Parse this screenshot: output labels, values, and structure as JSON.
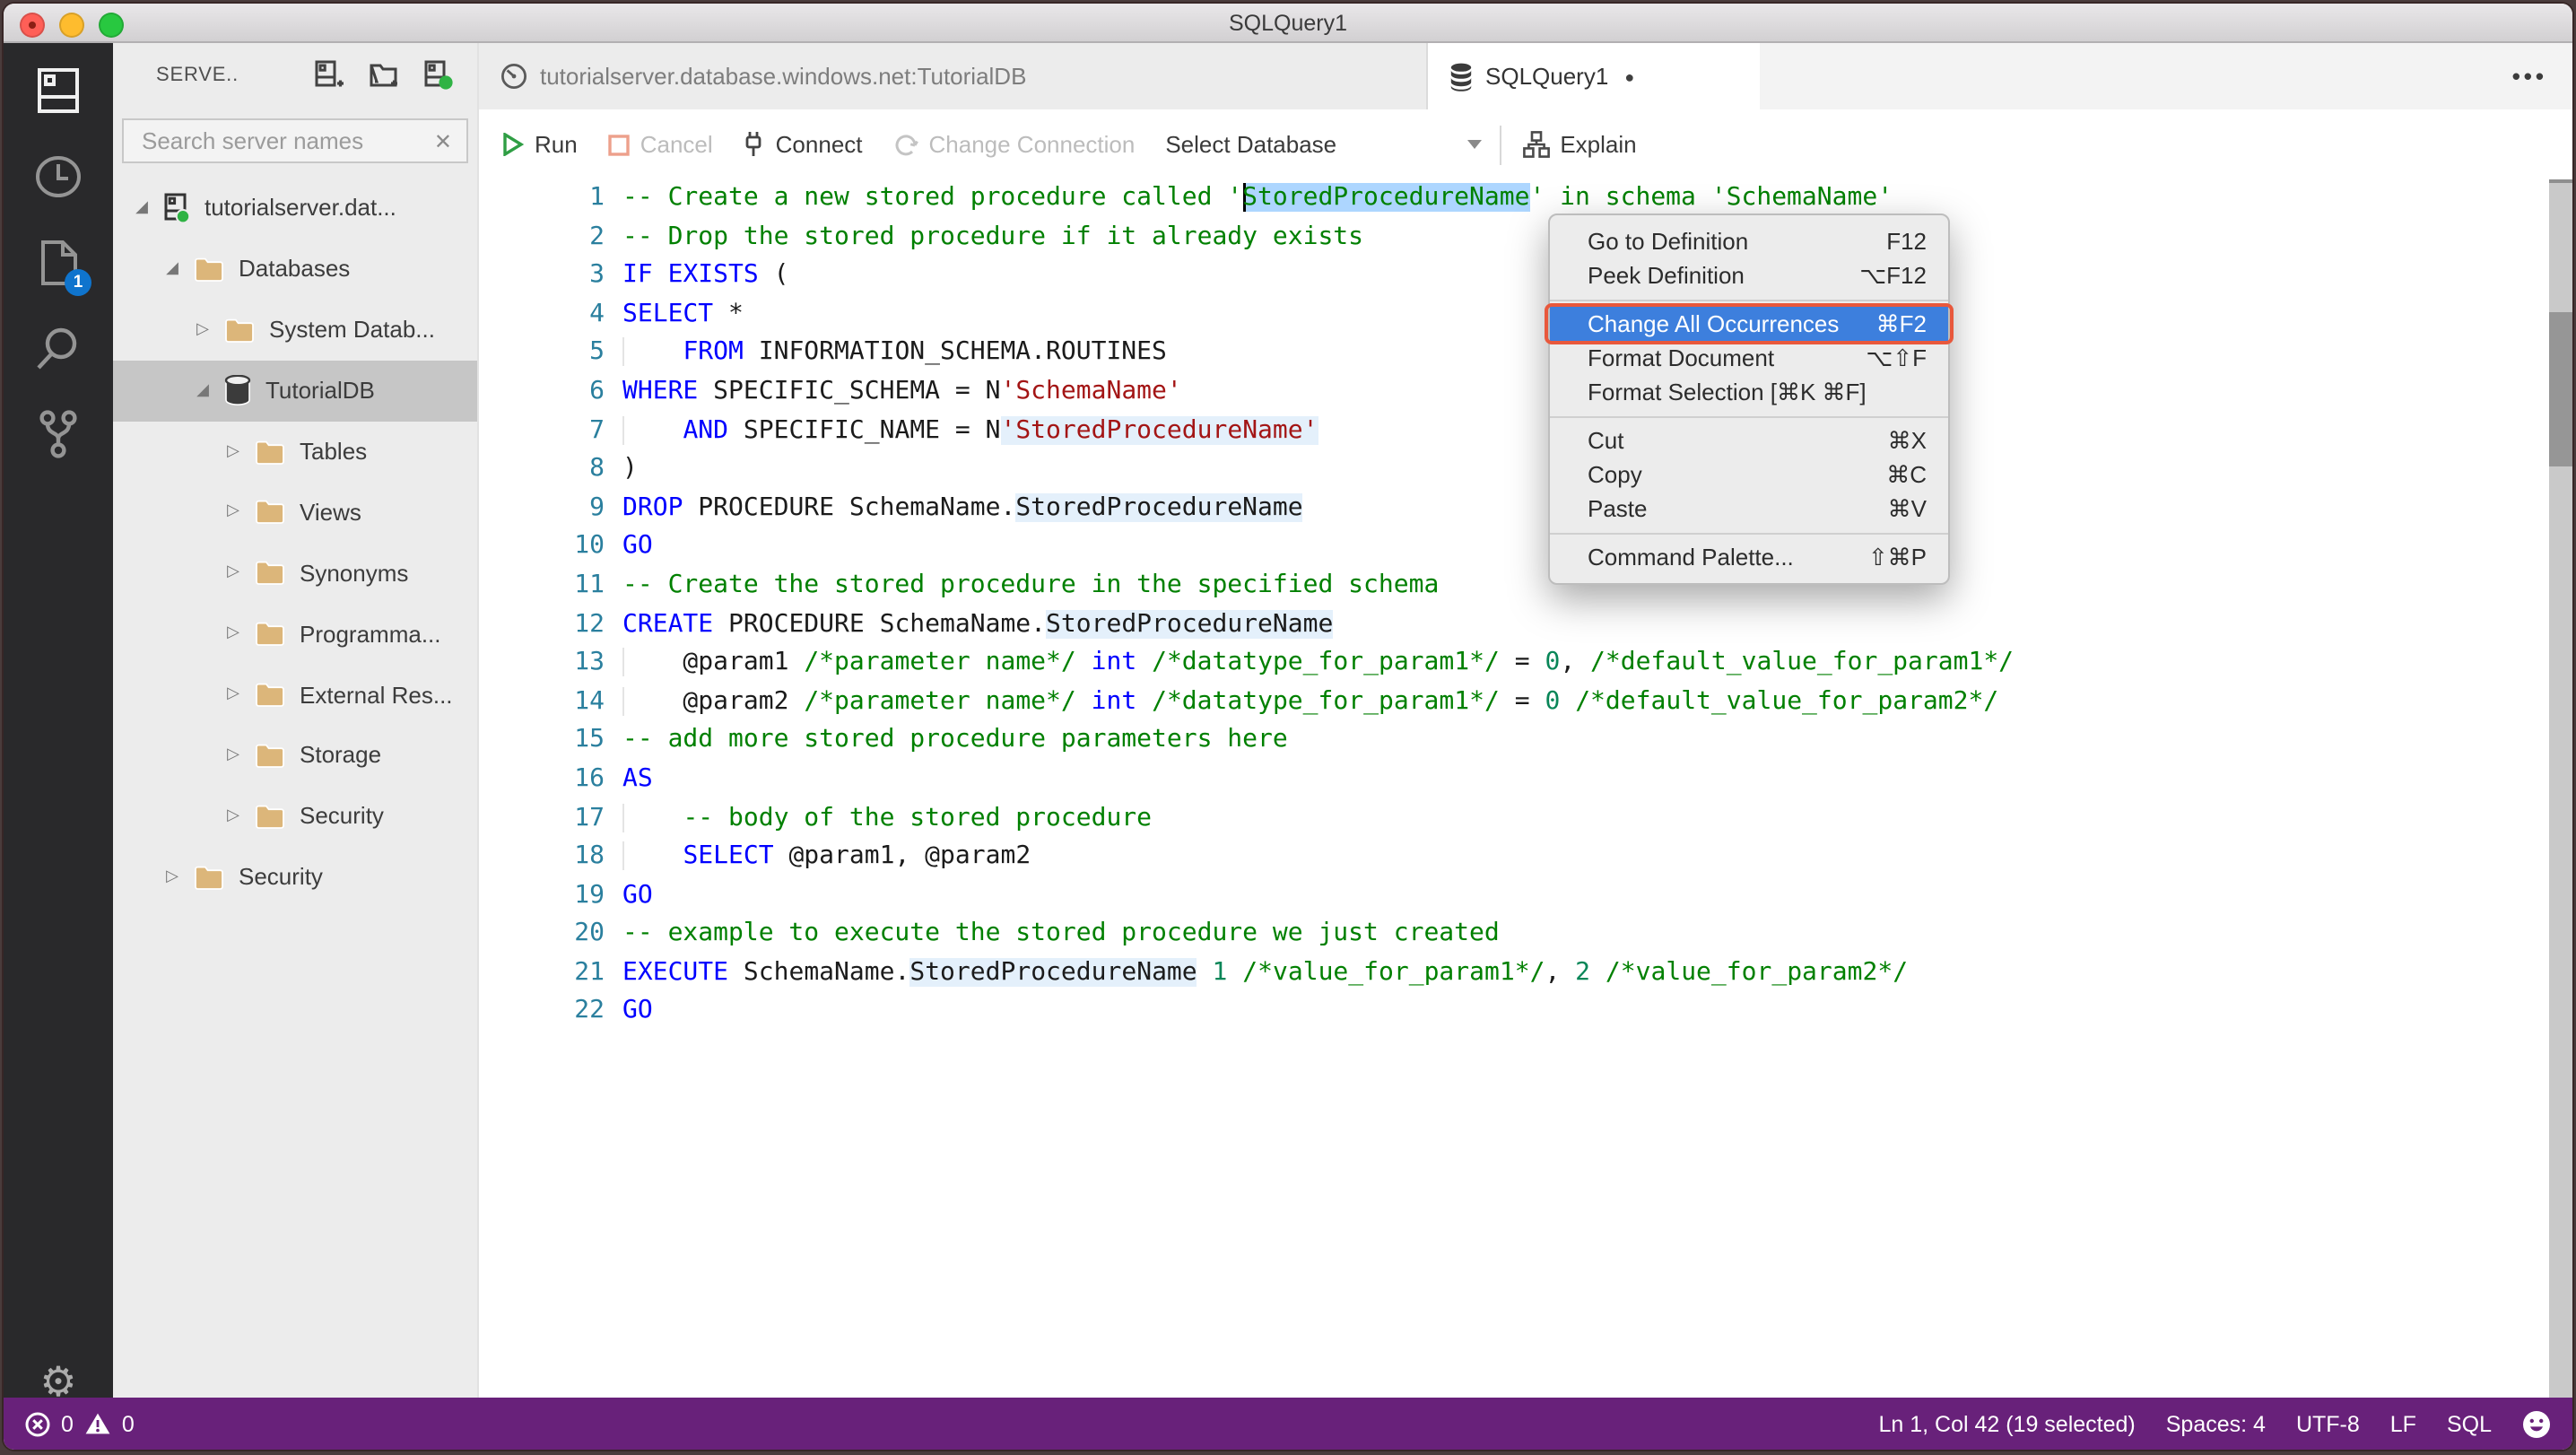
{
  "window": {
    "title": "SQLQuery1"
  },
  "icons": {
    "collapsed": "▷",
    "expanded": "◢",
    "close": "✕",
    "dirty": "●",
    "more": "•••",
    "gear": "⚙"
  },
  "colors": {
    "statusbar": "#68217a",
    "selection": "#add6ff",
    "occurrence": "#e4f0fb",
    "menu_highlight": "#3d7fdd",
    "annotation": "#e8583c",
    "badge": "#0f74cd"
  },
  "activity_bar": {
    "badge": "1",
    "items": [
      "servers-icon",
      "task-history-icon",
      "open-editors-icon",
      "search-icon",
      "source-control-icon",
      "settings-gear-icon"
    ]
  },
  "sidebar": {
    "header": {
      "title": "SERVE..",
      "actions": [
        "new-connection-icon",
        "new-server-group-icon",
        "active-connections-icon"
      ]
    },
    "search": {
      "placeholder": "Search server names",
      "clear": "✕"
    },
    "tree": {
      "items": [
        {
          "label": "tutorialserver.dat...",
          "depth": 0,
          "icon": "server",
          "expanded": true,
          "selected": false
        },
        {
          "label": "Databases",
          "depth": 1,
          "icon": "folder",
          "expanded": true,
          "selected": false
        },
        {
          "label": "System Datab...",
          "depth": 2,
          "icon": "folder",
          "expanded": false,
          "selected": false
        },
        {
          "label": "TutorialDB",
          "depth": 2,
          "icon": "db",
          "expanded": true,
          "selected": true
        },
        {
          "label": "Tables",
          "depth": 3,
          "icon": "folder",
          "expanded": false,
          "selected": false
        },
        {
          "label": "Views",
          "depth": 3,
          "icon": "folder",
          "expanded": false,
          "selected": false
        },
        {
          "label": "Synonyms",
          "depth": 3,
          "icon": "folder",
          "expanded": false,
          "selected": false
        },
        {
          "label": "Programma...",
          "depth": 3,
          "icon": "folder",
          "expanded": false,
          "selected": false
        },
        {
          "label": "External Res...",
          "depth": 3,
          "icon": "folder",
          "expanded": false,
          "selected": false
        },
        {
          "label": "Storage",
          "depth": 3,
          "icon": "folder",
          "expanded": false,
          "selected": false
        },
        {
          "label": "Security",
          "depth": 3,
          "icon": "folder",
          "expanded": false,
          "selected": false
        },
        {
          "label": "Security",
          "depth": 1,
          "icon": "folder",
          "expanded": false,
          "selected": false
        }
      ]
    }
  },
  "tabs": [
    {
      "label": "tutorialserver.database.windows.net:TutorialDB",
      "icon": "dashboard-icon",
      "active": false
    },
    {
      "label": "SQLQuery1",
      "icon": "database-icon",
      "active": true,
      "dirty": true
    }
  ],
  "tab_actions": {
    "more": "•••"
  },
  "toolbar": {
    "run": "Run",
    "cancel": "Cancel",
    "connect": "Connect",
    "change_connection": "Change Connection",
    "select_database": "Select Database",
    "explain": "Explain"
  },
  "editor": {
    "lines": [
      {
        "n": "1",
        "tokens": [
          {
            "t": "-- Create a new stored procedure called '",
            "c": "cm"
          },
          {
            "t": "StoredProcedureName",
            "c": "cm",
            "sel": true,
            "caret": true
          },
          {
            "t": "' in schema 'SchemaName'",
            "c": "cm"
          }
        ]
      },
      {
        "n": "2",
        "tokens": [
          {
            "t": "-- Drop the stored procedure if it already exists",
            "c": "cm"
          }
        ]
      },
      {
        "n": "3",
        "tokens": [
          {
            "t": "IF",
            "c": "kw"
          },
          {
            "t": " ",
            "c": "pl"
          },
          {
            "t": "EXISTS",
            "c": "kw"
          },
          {
            "t": " (",
            "c": "pl"
          }
        ]
      },
      {
        "n": "4",
        "tokens": [
          {
            "t": "SELECT",
            "c": "kw"
          },
          {
            "t": " *",
            "c": "pl"
          }
        ]
      },
      {
        "n": "5",
        "tokens": [
          {
            "t": "    ",
            "c": "pl",
            "g": true
          },
          {
            "t": "FROM",
            "c": "kw"
          },
          {
            "t": " INFORMATION_SCHEMA.ROUTINES",
            "c": "pl"
          }
        ]
      },
      {
        "n": "6",
        "tokens": [
          {
            "t": "WHERE",
            "c": "kw"
          },
          {
            "t": " SPECIFIC_SCHEMA = N",
            "c": "pl"
          },
          {
            "t": "'SchemaName'",
            "c": "str"
          }
        ]
      },
      {
        "n": "7",
        "tokens": [
          {
            "t": "    ",
            "c": "pl",
            "g": true
          },
          {
            "t": "AND",
            "c": "kw"
          },
          {
            "t": " SPECIFIC_NAME = N",
            "c": "pl"
          },
          {
            "t": "'StoredProcedureName'",
            "c": "str",
            "h": true
          }
        ]
      },
      {
        "n": "8",
        "tokens": [
          {
            "t": ")",
            "c": "pl"
          }
        ]
      },
      {
        "n": "9",
        "tokens": [
          {
            "t": "DROP",
            "c": "kw"
          },
          {
            "t": " PROCEDURE SchemaName.",
            "c": "pl"
          },
          {
            "t": "StoredProcedureName",
            "c": "pl",
            "h": true
          }
        ]
      },
      {
        "n": "10",
        "tokens": [
          {
            "t": "GO",
            "c": "kw"
          }
        ]
      },
      {
        "n": "11",
        "tokens": [
          {
            "t": "-- Create the stored procedure in the specified schema",
            "c": "cm"
          }
        ]
      },
      {
        "n": "12",
        "tokens": [
          {
            "t": "CREATE",
            "c": "kw"
          },
          {
            "t": " PROCEDURE SchemaName.",
            "c": "pl"
          },
          {
            "t": "StoredProcedureName",
            "c": "pl",
            "h": true
          }
        ]
      },
      {
        "n": "13",
        "tokens": [
          {
            "t": "    @param1 ",
            "c": "pl",
            "g": true
          },
          {
            "t": "/*parameter name*/",
            "c": "cm"
          },
          {
            "t": " ",
            "c": "pl"
          },
          {
            "t": "int",
            "c": "kw"
          },
          {
            "t": " ",
            "c": "pl"
          },
          {
            "t": "/*datatype_for_param1*/",
            "c": "cm"
          },
          {
            "t": " = ",
            "c": "pl"
          },
          {
            "t": "0",
            "c": "num"
          },
          {
            "t": ", ",
            "c": "pl"
          },
          {
            "t": "/*default_value_for_param1*/",
            "c": "cm"
          }
        ]
      },
      {
        "n": "14",
        "tokens": [
          {
            "t": "    @param2 ",
            "c": "pl",
            "g": true
          },
          {
            "t": "/*parameter name*/",
            "c": "cm"
          },
          {
            "t": " ",
            "c": "pl"
          },
          {
            "t": "int",
            "c": "kw"
          },
          {
            "t": " ",
            "c": "pl"
          },
          {
            "t": "/*datatype_for_param1*/",
            "c": "cm"
          },
          {
            "t": " = ",
            "c": "pl"
          },
          {
            "t": "0",
            "c": "num"
          },
          {
            "t": " ",
            "c": "pl"
          },
          {
            "t": "/*default_value_for_param2*/",
            "c": "cm"
          }
        ]
      },
      {
        "n": "15",
        "tokens": [
          {
            "t": "-- add more stored procedure parameters here",
            "c": "cm"
          }
        ]
      },
      {
        "n": "16",
        "tokens": [
          {
            "t": "AS",
            "c": "kw"
          }
        ]
      },
      {
        "n": "17",
        "tokens": [
          {
            "t": "    ",
            "c": "pl",
            "g": true
          },
          {
            "t": "-- body of the stored procedure",
            "c": "cm"
          }
        ]
      },
      {
        "n": "18",
        "tokens": [
          {
            "t": "    ",
            "c": "pl",
            "g": true
          },
          {
            "t": "SELECT",
            "c": "kw"
          },
          {
            "t": " @param1, @param2",
            "c": "pl"
          }
        ]
      },
      {
        "n": "19",
        "tokens": [
          {
            "t": "GO",
            "c": "kw"
          }
        ]
      },
      {
        "n": "20",
        "tokens": [
          {
            "t": "-- example to execute the stored procedure we just created",
            "c": "cm"
          }
        ]
      },
      {
        "n": "21",
        "tokens": [
          {
            "t": "EXECUTE",
            "c": "kw"
          },
          {
            "t": " SchemaName.",
            "c": "pl"
          },
          {
            "t": "StoredProcedureName",
            "c": "pl",
            "h": true
          },
          {
            "t": " ",
            "c": "pl"
          },
          {
            "t": "1",
            "c": "num"
          },
          {
            "t": " ",
            "c": "pl"
          },
          {
            "t": "/*value_for_param1*/",
            "c": "cm"
          },
          {
            "t": ", ",
            "c": "pl"
          },
          {
            "t": "2",
            "c": "num"
          },
          {
            "t": " ",
            "c": "pl"
          },
          {
            "t": "/*value_for_param2*/",
            "c": "cm"
          }
        ]
      },
      {
        "n": "22",
        "tokens": [
          {
            "t": "GO",
            "c": "kw"
          }
        ]
      }
    ]
  },
  "context_menu": {
    "items": [
      {
        "label": "Go to Definition",
        "shortcut": "F12"
      },
      {
        "label": "Peek Definition",
        "shortcut": "⌥F12"
      },
      {
        "sep": true
      },
      {
        "label": "Change All Occurrences",
        "shortcut": "⌘F2",
        "highlighted": true,
        "annotated": true
      },
      {
        "label": "Format Document",
        "shortcut": "⌥⇧F"
      },
      {
        "label": "Format Selection [⌘K ⌘F]",
        "shortcut": ""
      },
      {
        "sep": true
      },
      {
        "label": "Cut",
        "shortcut": "⌘X"
      },
      {
        "label": "Copy",
        "shortcut": "⌘C"
      },
      {
        "label": "Paste",
        "shortcut": "⌘V"
      },
      {
        "sep": true
      },
      {
        "label": "Command Palette...",
        "shortcut": "⇧⌘P"
      }
    ]
  },
  "status_bar": {
    "errors": "0",
    "warnings": "0",
    "cursor": "Ln 1, Col 42 (19 selected)",
    "spaces": "Spaces: 4",
    "encoding": "UTF-8",
    "eol": "LF",
    "language": "SQL"
  }
}
